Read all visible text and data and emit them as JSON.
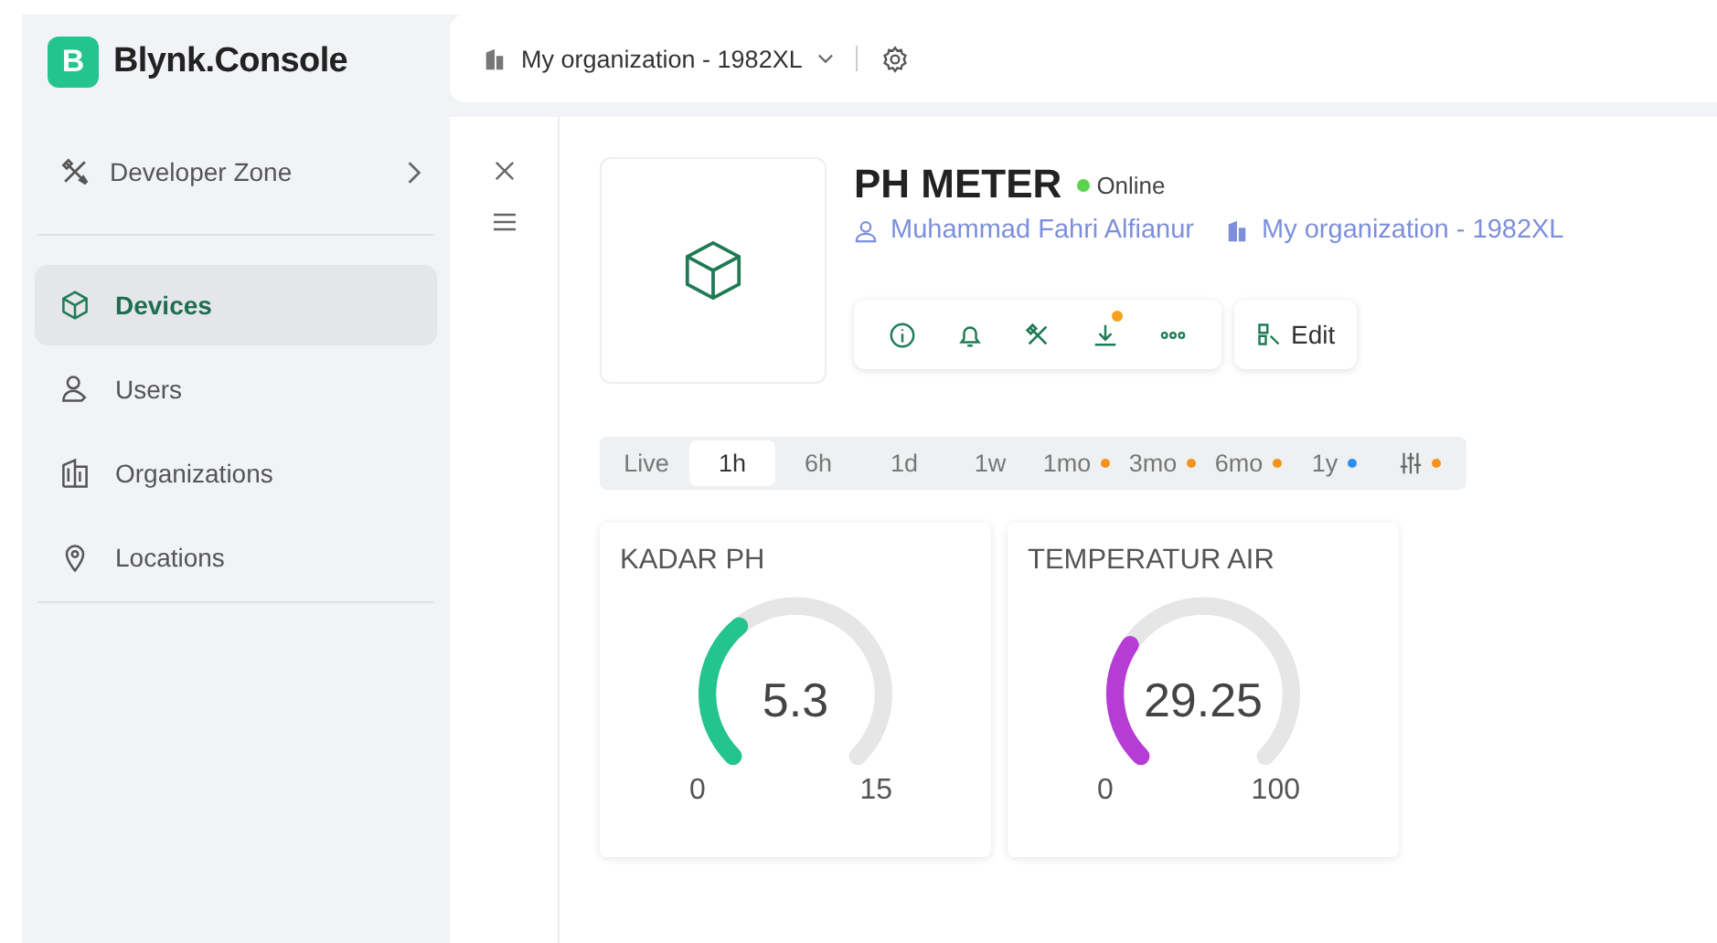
{
  "brand": {
    "logo_letter": "B",
    "name": "Blynk.Console"
  },
  "org_selector": {
    "label": "My organization - 1982XL"
  },
  "sidebar": {
    "developer_zone": "Developer Zone",
    "items": [
      {
        "kind": "devices",
        "label": "Devices",
        "selected": true
      },
      {
        "kind": "users",
        "label": "Users",
        "selected": false
      },
      {
        "kind": "organizations",
        "label": "Organizations",
        "selected": false
      },
      {
        "kind": "locations",
        "label": "Locations",
        "selected": false
      }
    ]
  },
  "device": {
    "name": "PH METER",
    "status": "Online",
    "online": true,
    "owner": "Muhammad Fahri Alfianur",
    "organization": "My organization - 1982XL",
    "actions": [
      {
        "kind": "info",
        "notification": false
      },
      {
        "kind": "bell",
        "notification": false
      },
      {
        "kind": "tools",
        "notification": false
      },
      {
        "kind": "download",
        "notification": true
      },
      {
        "kind": "more",
        "notification": false
      }
    ],
    "edit_button": "Edit"
  },
  "time_ranges": [
    {
      "kind": "text",
      "label": "Live",
      "selected": false
    },
    {
      "kind": "text",
      "label": "1h",
      "selected": true
    },
    {
      "kind": "text",
      "label": "6h",
      "selected": false
    },
    {
      "kind": "text",
      "label": "1d",
      "selected": false
    },
    {
      "kind": "text",
      "label": "1w",
      "selected": false
    },
    {
      "kind": "text",
      "label": "1mo",
      "selected": false,
      "color": "#f5921e"
    },
    {
      "kind": "text",
      "label": "3mo",
      "selected": false,
      "color": "#f5921e"
    },
    {
      "kind": "text",
      "label": "6mo",
      "selected": false,
      "color": "#f5921e"
    },
    {
      "kind": "text",
      "label": "1y",
      "selected": false,
      "color": "#2f8ff0"
    },
    {
      "kind": "icon",
      "selected": false,
      "color": "#f5921e"
    }
  ],
  "gauges": [
    {
      "title": "KADAR PH",
      "value": "5.3",
      "min": "0",
      "max": "15",
      "color": "#23c48e"
    },
    {
      "title": "TEMPERATUR AIR",
      "value": "29.25",
      "min": "0",
      "max": "100",
      "color": "#b53dd6"
    }
  ]
}
